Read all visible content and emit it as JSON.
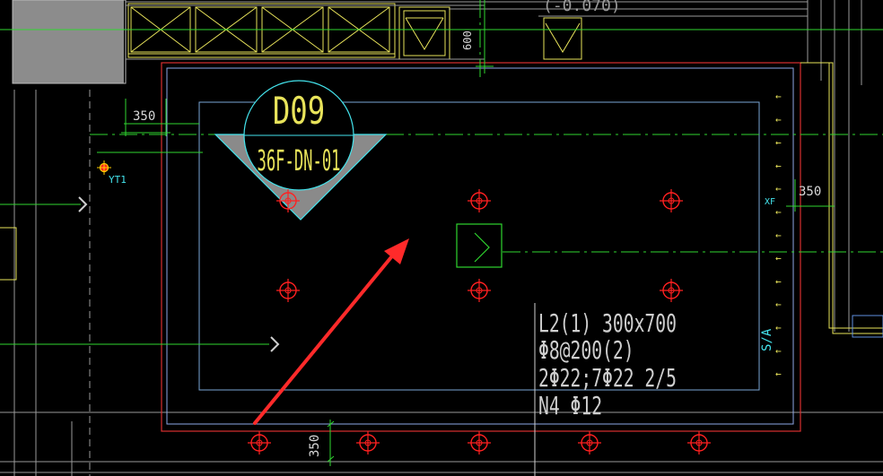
{
  "drawing": {
    "column_tag": "D09",
    "column_code": "36F-DN-01",
    "dim_left": "350",
    "dim_right": "350",
    "dim_bottom": "350",
    "dim_top": "600",
    "top_note": "(-0.070)",
    "marker_label": "YT1",
    "right_label_xf": "XF",
    "right_label_sa": "S/A",
    "beam_label": {
      "line1": "L2(1) 300x700",
      "line2": "Φ8@200(2)",
      "line3": "2Φ22;7Φ22 2/5",
      "line4": "N4 Φ12"
    }
  },
  "colors": {
    "background": "#000000",
    "cad_red": "#ff2020",
    "cad_cyan": "#44e5ee",
    "cad_green": "#2fd62f",
    "cad_yellow": "#e8e35a",
    "cad_white": "#d8d8d8",
    "cad_blue": "#5f8fe0",
    "annotation_arrow": "#ff2a2a"
  },
  "icons": [
    "red-target-symbol",
    "green-section-symbol",
    "yellow-arrow-marker",
    "red-annotation-arrow"
  ]
}
